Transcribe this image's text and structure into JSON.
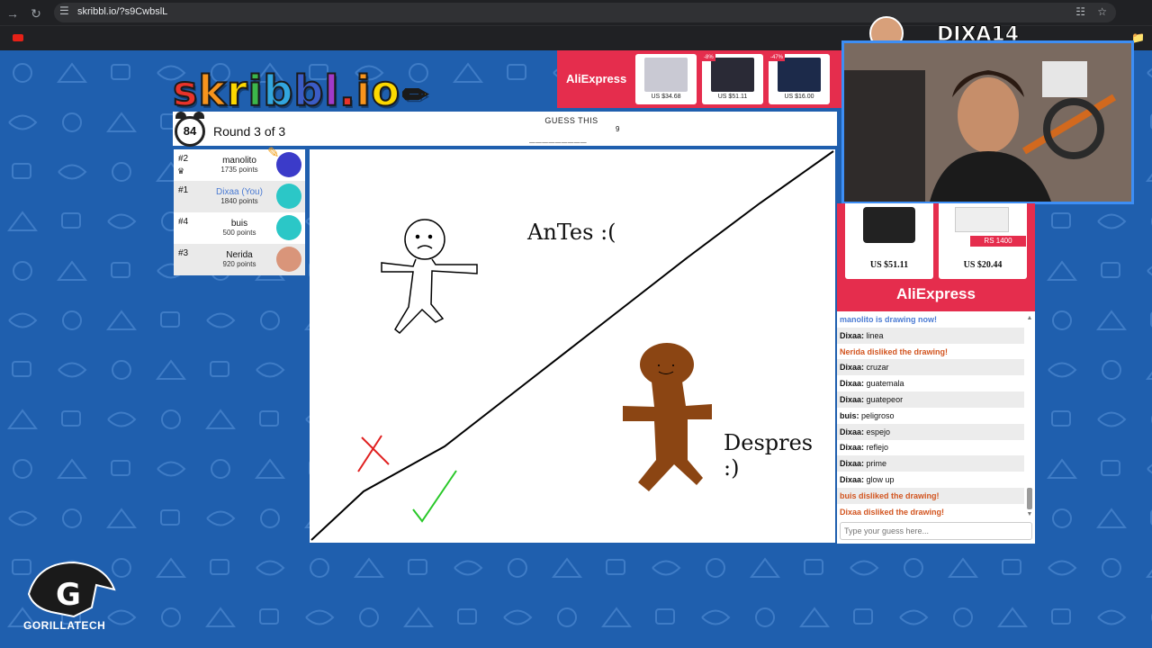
{
  "browser": {
    "url": "skribbl.io/?s9CwbslL"
  },
  "logo": {
    "text": "skribbl.io",
    "letters": [
      "s",
      "k",
      "r",
      "i",
      "b",
      "b",
      "l",
      ".",
      "i",
      "o"
    ],
    "colors": [
      "#e8332a",
      "#f7941d",
      "#fcd800",
      "#3cb64a",
      "#32a6de",
      "#3b5cc6",
      "#a23ac8",
      "#e8332a",
      "#f7941d",
      "#fcd800"
    ]
  },
  "ad_top": {
    "brand": "AliExpress",
    "items": [
      {
        "price": "US $34.68",
        "badge": ""
      },
      {
        "price": "US $51.11",
        "badge": "-8%"
      },
      {
        "price": "US $16.00",
        "badge": "-47%"
      }
    ]
  },
  "game": {
    "timer": "84",
    "round": "Round 3 of 3",
    "guess_label": "GUESS THIS",
    "hint": "_________",
    "hint_length": "9"
  },
  "players": [
    {
      "rank": "#2",
      "name": "manolito",
      "points": "1735 points",
      "me": false,
      "avatar_color": "#3b3bc9",
      "drawing": true
    },
    {
      "rank": "#1",
      "name": "Dixaa (You)",
      "points": "1840 points",
      "me": true,
      "avatar_color": "#2bc7c7",
      "drawing": false
    },
    {
      "rank": "#4",
      "name": "buis",
      "points": "500 points",
      "me": false,
      "avatar_color": "#2bc7c7",
      "drawing": false
    },
    {
      "rank": "#3",
      "name": "Nerida",
      "points": "920 points",
      "me": false,
      "avatar_color": "#d9957a",
      "drawing": false
    }
  ],
  "canvas": {
    "text_before": "AnTes :(",
    "text_after": "Despres :)"
  },
  "stream": {
    "streamer": "DIXA14"
  },
  "ad_right": {
    "brand": "AliExpress",
    "items": [
      {
        "price": "US $51.11"
      },
      {
        "price": "US $20.44",
        "tag": "RS 1400"
      }
    ]
  },
  "chat": {
    "messages": [
      {
        "type": "sys-blue",
        "user": "",
        "text": "manolito is drawing now!"
      },
      {
        "type": "msg",
        "user": "Dixaa:",
        "text": "linea"
      },
      {
        "type": "sys-red",
        "user": "",
        "text": "Nerida disliked the drawing!"
      },
      {
        "type": "msg",
        "user": "Dixaa:",
        "text": "cruzar"
      },
      {
        "type": "msg",
        "user": "Dixaa:",
        "text": "guatemala"
      },
      {
        "type": "msg",
        "user": "Dixaa:",
        "text": "guatepeor"
      },
      {
        "type": "msg",
        "user": "buis:",
        "text": "peligroso"
      },
      {
        "type": "msg",
        "user": "Dixaa:",
        "text": "espejo"
      },
      {
        "type": "msg",
        "user": "Dixaa:",
        "text": "reflejo"
      },
      {
        "type": "msg",
        "user": "Dixaa:",
        "text": "prime"
      },
      {
        "type": "msg",
        "user": "Dixaa:",
        "text": "glow up"
      },
      {
        "type": "sys-red",
        "user": "",
        "text": "buis disliked the drawing!"
      },
      {
        "type": "sys-red",
        "user": "",
        "text": "Dixaa disliked the drawing!"
      }
    ],
    "input_placeholder": "Type your guess here..."
  },
  "watermark": {
    "text": "GORILLATECH"
  }
}
